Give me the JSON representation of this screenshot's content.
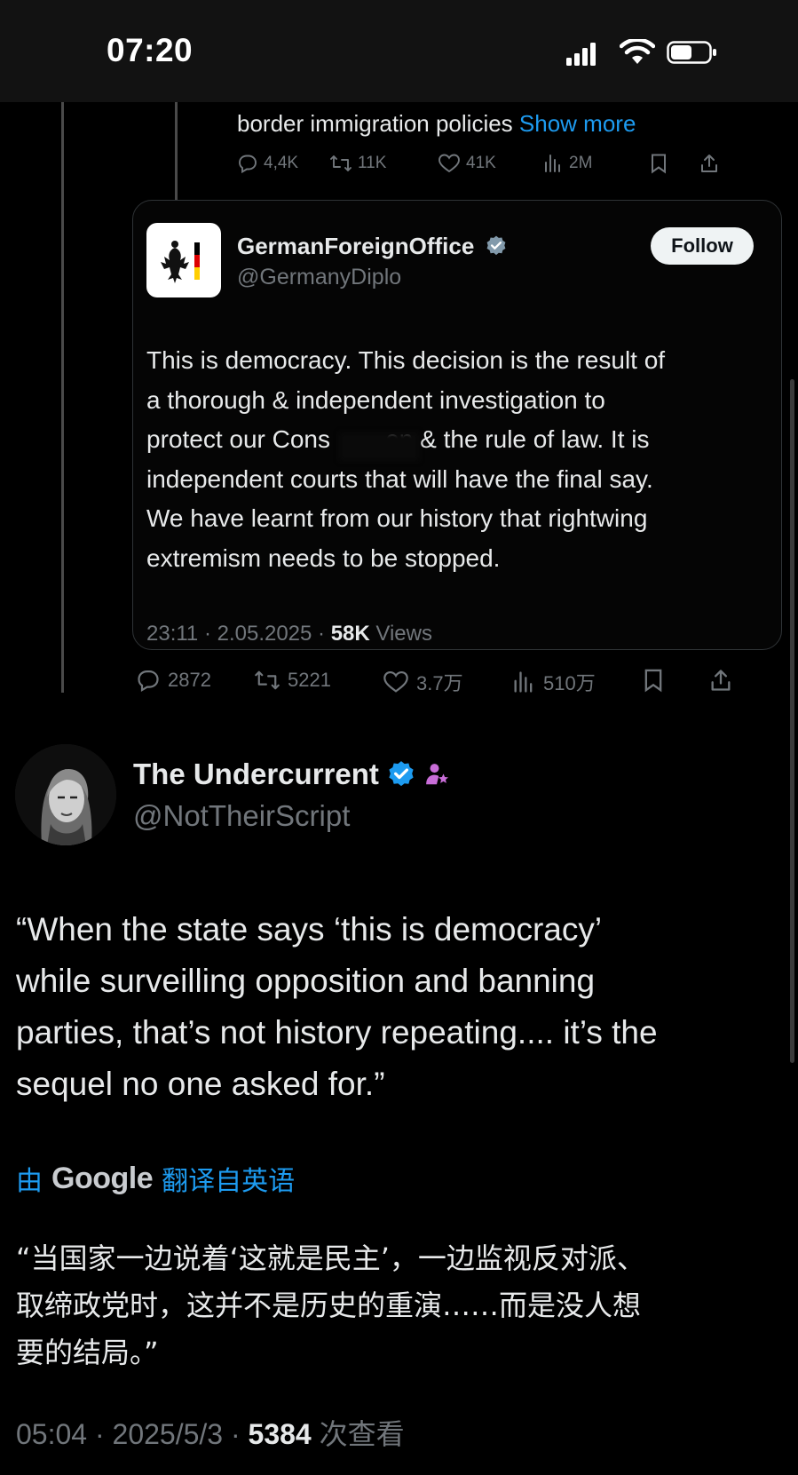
{
  "status_bar": {
    "time": "07:20"
  },
  "previous_tweet": {
    "text_tail": "border immigration policies",
    "show_more": "Show more",
    "actions": {
      "replies": "4,4K",
      "reposts": "11K",
      "likes": "41K",
      "views": "2M"
    }
  },
  "quoted_tweet": {
    "author_name": "GermanForeignOffice",
    "handle": "@GermanyDiplo",
    "follow_label": "Follow",
    "body_lines": [
      "This is democracy. This decision is the result of",
      "a thorough & independent investigation to",
      "protect our Cons        on & the rule of law. It is",
      "independent courts that will have the final say.",
      "We have learnt from our history that rightwing",
      "extremism needs to be stopped."
    ],
    "time": "23:11 · 2.05.2025 · ",
    "views_count": "58K",
    "views_label": " Views"
  },
  "reply_actions": {
    "replies": "2872",
    "reposts": "5221",
    "likes": "3.7万",
    "views": "510万"
  },
  "author": {
    "name": "The Undercurrent",
    "handle": "@NotTheirScript"
  },
  "tweet": {
    "lines": [
      "“When the state says ‘this is democracy’",
      "while surveilling opposition and banning",
      "parties, that’s not history repeating.... it’s the",
      "sequel no one asked for.”"
    ]
  },
  "translation": {
    "prefix": "由",
    "brand": "Google",
    "suffix": "翻译自英语",
    "lines": [
      "“当国家一边说着‘这就是民主’，一边监视反对派、",
      "取缔政党时，这并不是历史的重演……而是没人想",
      "要的结局。”"
    ]
  },
  "post_meta": {
    "time": "05:04 · 2025/5/3 · ",
    "views_count": "5384",
    "views_label": " 次查看"
  },
  "colors": {
    "accent": "#1d9bf0",
    "muted": "#71767b",
    "text": "#e7e9ea",
    "background": "#000000"
  }
}
